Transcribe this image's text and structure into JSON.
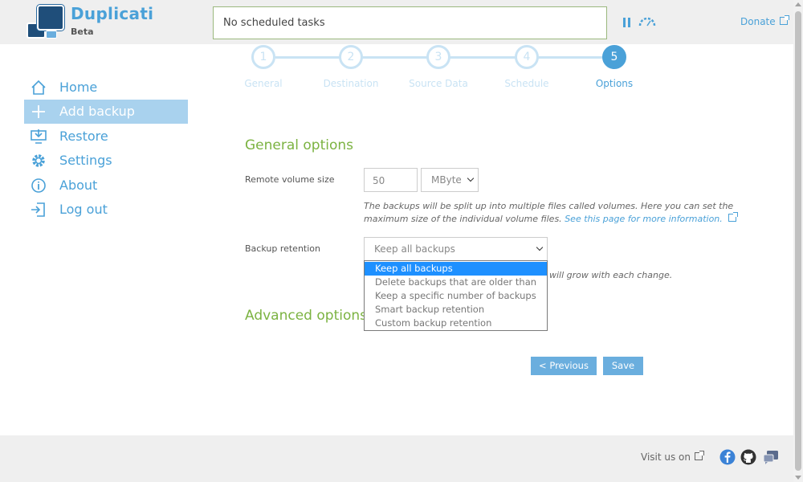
{
  "header": {
    "app_name": "Duplicati",
    "app_badge": "Beta",
    "status": "No scheduled tasks",
    "donate_label": "Donate"
  },
  "sidebar": {
    "items": [
      {
        "label": "Home",
        "icon": "home-icon"
      },
      {
        "label": "Add backup",
        "icon": "plus-icon",
        "active": true
      },
      {
        "label": "Restore",
        "icon": "restore-icon"
      },
      {
        "label": "Settings",
        "icon": "gear-icon"
      },
      {
        "label": "About",
        "icon": "info-icon"
      },
      {
        "label": "Log out",
        "icon": "logout-icon"
      }
    ]
  },
  "steps": [
    {
      "number": "1",
      "label": "General"
    },
    {
      "number": "2",
      "label": "Destination"
    },
    {
      "number": "3",
      "label": "Source Data"
    },
    {
      "number": "4",
      "label": "Schedule"
    },
    {
      "number": "5",
      "label": "Options",
      "active": true
    }
  ],
  "general_options": {
    "title": "General options",
    "volume_label": "Remote volume size",
    "volume_value": "50",
    "volume_unit": "MByte",
    "volume_help_1": "The backups will be split up into multiple files called volumes. Here you can set the",
    "volume_help_2": "maximum size of the individual volume files.",
    "volume_help_link": "See this page for more information.",
    "retention_label": "Backup retention",
    "retention_value": "Keep all backups",
    "retention_help": "will grow with each change.",
    "retention_options": [
      "Keep all backups",
      "Delete backups that are older than",
      "Keep a specific number of backups",
      "Smart backup retention",
      "Custom backup retention"
    ]
  },
  "advanced_options": {
    "title": "Advanced options"
  },
  "buttons": {
    "previous": "< Previous",
    "save": "Save"
  },
  "footer": {
    "visit_label": "Visit us on",
    "icons": [
      "facebook-icon",
      "github-icon",
      "forum-icon"
    ]
  },
  "colors": {
    "accent": "#4aa1d8",
    "section_title": "#7cb342",
    "active_nav": "#a9d2ee",
    "button": "#6aaede",
    "dropdown_selected": "#1e90ff"
  }
}
